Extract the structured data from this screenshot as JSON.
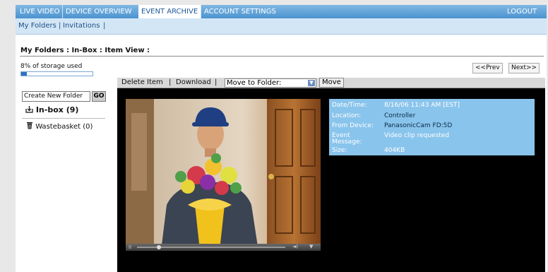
{
  "topnav": {
    "tabs": [
      "LIVE VIDEO",
      "DEVICE OVERVIEW",
      "EVENT ARCHIVE",
      "ACCOUNT SETTINGS"
    ],
    "active_tab": "EVENT ARCHIVE",
    "logout": "LOGOUT"
  },
  "subnav": {
    "my_folders": "My Folders",
    "invitations": "Invitations"
  },
  "breadcrumb": "My Folders : In-Box : Item View :",
  "storage": {
    "label": "8% of storage used",
    "percent": 8
  },
  "pager": {
    "prev": "<<Prev",
    "next": "Next>>"
  },
  "sidebar": {
    "create_folder": "Create New Folder",
    "go": "GO",
    "folders": [
      {
        "name": "In-box (9)",
        "icon": "inbox-icon"
      },
      {
        "name": "Wastebasket (0)",
        "icon": "trash-icon"
      }
    ]
  },
  "toolbar": {
    "delete": "Delete Item",
    "download": "Download",
    "move_to_folder": "Move to Folder:",
    "move": "Move"
  },
  "details": {
    "datetime_label": "Date/Time:",
    "datetime": "8/16/06 11:43 AM [EST]",
    "location_label": "Location:",
    "location": "Controller",
    "device_label": "From Device:",
    "device": "PanasonicCam FD:5D",
    "event_label_1": "Event",
    "event_label_2": "Message:",
    "event": "Video clip requested",
    "size_label": "Size:",
    "size": "404KB"
  },
  "colors": {
    "nav": "#4c93cf",
    "info_panel": "#89c4ec",
    "viewer_bg": "#000000"
  }
}
